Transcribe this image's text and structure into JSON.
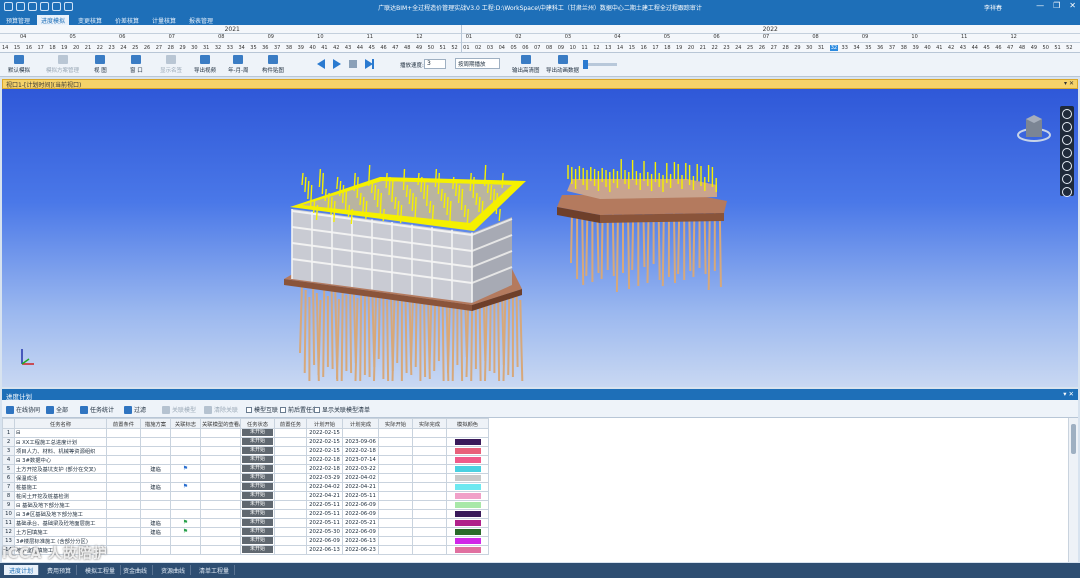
{
  "app": {
    "title": "广联达BIM+全过程造价管理实战V3.0 工程:D:\\WorkSpace\\中建科工（甘肃兰州）数据中心二期土建工程全过程跟踪审计",
    "user": "李祥春",
    "window_controls": [
      "—",
      "❐",
      "✕"
    ]
  },
  "menu": {
    "tabs": [
      "预算管理",
      "进度模拟",
      "变更核算",
      "价差核算",
      "计量核算",
      "报表管理"
    ],
    "active": "进度模拟"
  },
  "timeline": {
    "years": [
      "2021",
      "2022"
    ],
    "months": [
      "04",
      "05",
      "06",
      "07",
      "08",
      "09",
      "10",
      "11",
      "12",
      "01",
      "02",
      "03",
      "04",
      "05",
      "06",
      "07",
      "08",
      "09",
      "10",
      "11",
      "12"
    ],
    "weeks": [
      "14",
      "15",
      "16",
      "17",
      "18",
      "19",
      "20",
      "21",
      "22",
      "23",
      "24",
      "25",
      "26",
      "27",
      "28",
      "29",
      "30",
      "31",
      "32",
      "33",
      "34",
      "35",
      "36",
      "37",
      "38",
      "39",
      "40",
      "41",
      "42",
      "43",
      "44",
      "45",
      "46",
      "47",
      "48",
      "49",
      "50",
      "51",
      "52",
      "01",
      "02",
      "03",
      "04",
      "05",
      "06",
      "07",
      "08",
      "09",
      "10",
      "11",
      "12",
      "13",
      "14",
      "15",
      "16",
      "17",
      "18",
      "19",
      "20",
      "21",
      "22",
      "23",
      "24",
      "25",
      "26",
      "27",
      "28",
      "29",
      "30",
      "31",
      "32",
      "33",
      "34",
      "35",
      "36",
      "37",
      "38",
      "39",
      "40",
      "41",
      "42",
      "43",
      "44",
      "45",
      "46",
      "47",
      "48",
      "49",
      "50",
      "51",
      "52"
    ],
    "selected_week": "32"
  },
  "toolbar": {
    "buttons": [
      {
        "label": "默认模拟",
        "dim": false
      },
      {
        "label": "模拟方案管理",
        "dim": true
      },
      {
        "label": "视 图",
        "dim": false
      },
      {
        "label": "窗 口",
        "dim": false
      },
      {
        "label": "显示名签",
        "dim": true
      },
      {
        "label": "导出视频",
        "dim": false
      },
      {
        "label": "年-月-周",
        "dim": false
      },
      {
        "label": "构件贴图",
        "dim": false
      }
    ],
    "speed_label": "播放速度:",
    "speed_value": "3",
    "mode_select": "",
    "mode_value": "按周期播放",
    "right_buttons": [
      "输出高清图",
      "导出动画数据"
    ]
  },
  "viewport": {
    "title": "视口1-[计划时间](当前视口)",
    "controls": "▾ ✕"
  },
  "schedule": {
    "title": "进度计划",
    "controls": "▾ ✕",
    "tools": [
      {
        "label": "在线协同",
        "dim": false
      },
      {
        "label": "全部",
        "dim": false
      },
      {
        "label": "任务统计",
        "dim": false
      },
      {
        "label": "过滤",
        "dim": false
      },
      {
        "label": "关联模型",
        "dim": true
      },
      {
        "label": "清除关联",
        "dim": true
      }
    ],
    "checks": [
      "模型互联",
      "前后置任务",
      "显示关联模型清单"
    ],
    "columns": [
      "",
      "任务名称",
      "前置条件",
      "措施方案",
      "关联标志",
      "关联模型的查看/勤务",
      "任务状态",
      "前置任务",
      "计划开始",
      "计划完成",
      "实际开始",
      "实际完成",
      "模拟颜色"
    ],
    "rows": [
      {
        "no": "1",
        "name": "⊟",
        "pre": "",
        "plan": "",
        "flag": "",
        "status": "未开始",
        "start": "2022-02-15",
        "end": "",
        "color": ""
      },
      {
        "no": "2",
        "name": "⊟ XX工程施工总进度计划",
        "pre": "",
        "plan": "",
        "flag": "",
        "status": "未开始",
        "start": "2022-02-15",
        "end": "2023-09-06",
        "color": "#3a1a5a"
      },
      {
        "no": "3",
        "name": "   项目人力、材料、机械等资源组织",
        "pre": "",
        "plan": "",
        "flag": "",
        "status": "未开始",
        "start": "2022-02-15",
        "end": "2022-02-18",
        "color": "#e8607a"
      },
      {
        "no": "4",
        "name": " ⊟ 3#数据中心",
        "pre": "",
        "plan": "",
        "flag": "",
        "status": "未开始",
        "start": "2022-02-18",
        "end": "2023-07-14",
        "color": "#f05a8a"
      },
      {
        "no": "5",
        "name": "   土方开挖及基坑支护 (部分在交叉)",
        "pre": "",
        "plan": "建临",
        "flag": "blue",
        "status": "未开始",
        "start": "2022-02-18",
        "end": "2022-03-22",
        "color": "#4ad0e0"
      },
      {
        "no": "6",
        "name": "   保温成活",
        "pre": "",
        "plan": "",
        "flag": "",
        "status": "未开始",
        "start": "2022-03-29",
        "end": "2022-04-02",
        "color": "#c8c8c8"
      },
      {
        "no": "7",
        "name": "   桩基施工",
        "pre": "",
        "plan": "建临",
        "flag": "blue",
        "status": "未开始",
        "start": "2022-04-02",
        "end": "2022-04-21",
        "color": "#6ee8f0"
      },
      {
        "no": "8",
        "name": "   桩间土开挖及桩基检测",
        "pre": "",
        "plan": "",
        "flag": "",
        "status": "未开始",
        "start": "2022-04-21",
        "end": "2022-05-11",
        "color": "#f0a0c8"
      },
      {
        "no": "9",
        "name": "  ⊟ 基础及地下部分施工",
        "pre": "",
        "plan": "",
        "flag": "",
        "status": "未开始",
        "start": "2022-05-11",
        "end": "2022-06-09",
        "color": "#a8e8a8"
      },
      {
        "no": "10",
        "name": "   ⊟ 3#区基础及地下部分施工",
        "pre": "",
        "plan": "",
        "flag": "",
        "status": "未开始",
        "start": "2022-05-11",
        "end": "2022-06-09",
        "color": "#3a1a5a"
      },
      {
        "no": "11",
        "name": "     基础承台、基础梁及砼地面层施工",
        "pre": "",
        "plan": "建临",
        "flag": "green",
        "status": "未开始",
        "start": "2022-05-11",
        "end": "2022-05-21",
        "color": "#b0208a"
      },
      {
        "no": "12",
        "name": "     土方回填施工",
        "pre": "",
        "plan": "建临",
        "flag": "green",
        "status": "未开始",
        "start": "2022-05-30",
        "end": "2022-06-09",
        "color": "#2a6a2a"
      },
      {
        "no": "13",
        "name": "     3#楼层标准施工 (含部分分区)",
        "pre": "",
        "plan": "",
        "flag": "",
        "status": "未开始",
        "start": "2022-06-09",
        "end": "2022-06-13",
        "color": "#d028e8"
      },
      {
        "no": "14",
        "name": "     地下室回填施工",
        "pre": "",
        "plan": "",
        "flag": "",
        "status": "未开始",
        "start": "2022-06-13",
        "end": "2022-06-23",
        "color": "#e070a0"
      }
    ]
  },
  "bottom_tabs": {
    "tabs": [
      "进度计划",
      "费用预算",
      "模拟工程量",
      "资金曲线",
      "资源曲线",
      "清单工程量"
    ],
    "active": "进度计划"
  },
  "watermark": "iCCA 人故陪护",
  "accent": "#1e6fb8",
  "sky_top": "#2f58d8",
  "highlight": "#f5f000"
}
